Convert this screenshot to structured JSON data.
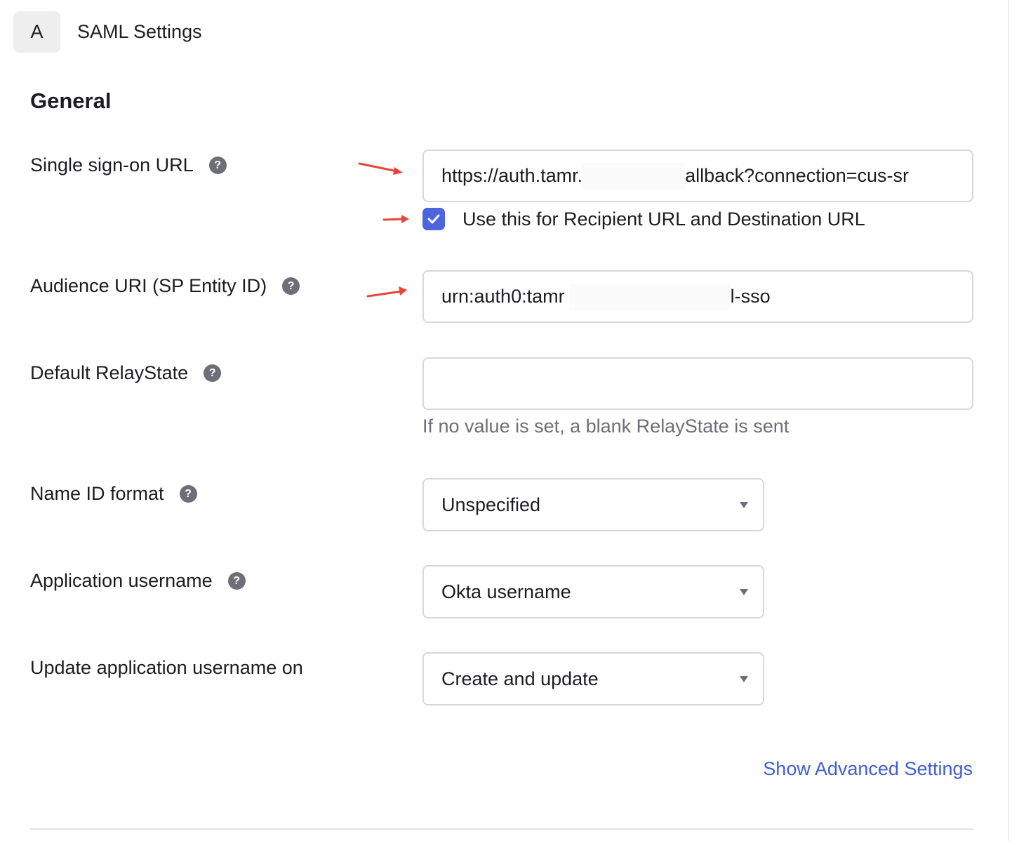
{
  "header": {
    "step_letter": "A",
    "title": "SAML Settings"
  },
  "section": {
    "title": "General"
  },
  "fields": {
    "sso_url": {
      "label": "Single sign-on URL",
      "value_start": "https://auth.tamr.",
      "value_end": "allback?connection=cus-sr",
      "checkbox_checked": true,
      "checkbox_label": "Use this for Recipient URL and Destination URL"
    },
    "audience_uri": {
      "label": "Audience URI (SP Entity ID)",
      "value_start": "urn:auth0:tamr",
      "value_end": "l-sso"
    },
    "relay_state": {
      "label": "Default RelayState",
      "value": "",
      "helper": "If no value is set, a blank RelayState is sent"
    },
    "name_id_format": {
      "label": "Name ID format",
      "selected": "Unspecified"
    },
    "app_username": {
      "label": "Application username",
      "selected": "Okta username"
    },
    "update_username_on": {
      "label": "Update application username on",
      "selected": "Create and update"
    }
  },
  "links": {
    "advanced": "Show Advanced Settings"
  },
  "colors": {
    "accent": "#4c64de",
    "link": "#3f5fd1",
    "annotation_arrow": "#e8453c",
    "help_icon": "#6e6e78"
  },
  "icons": {
    "help": "question-circle-icon",
    "caret": "caret-down-icon",
    "check": "checkmark-icon",
    "annotation": "red-arrow-annotation"
  }
}
